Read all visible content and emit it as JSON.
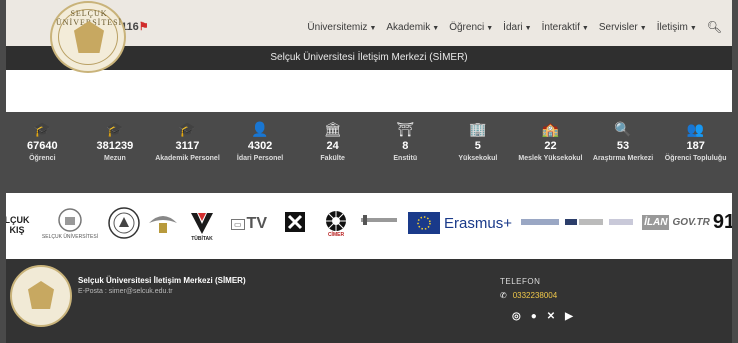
{
  "header": {
    "logo_text": "SELÇUK ÜNİVERSİTESİ",
    "badge": "116",
    "nav": [
      "Üniversitemiz",
      "Akademik",
      "Öğrenci",
      "İdari",
      "İnteraktif",
      "Servisler",
      "İletişim"
    ]
  },
  "title_bar": "Selçuk Üniversitesi İletişim Merkezi (SİMER)",
  "stats": [
    {
      "icon": "student-icon",
      "glyph": "🎓",
      "value": "67640",
      "label": "Öğrenci"
    },
    {
      "icon": "graduate-icon",
      "glyph": "🎓",
      "value": "381239",
      "label": "Mezun"
    },
    {
      "icon": "academic-staff-icon",
      "glyph": "🎓",
      "value": "3117",
      "label": "Akademik Personel"
    },
    {
      "icon": "admin-staff-icon",
      "glyph": "👤",
      "value": "4302",
      "label": "İdari Personel"
    },
    {
      "icon": "faculty-icon",
      "glyph": "🏛",
      "value": "24",
      "label": "Fakülte"
    },
    {
      "icon": "institute-icon",
      "glyph": "⛩",
      "value": "8",
      "label": "Enstitü"
    },
    {
      "icon": "school-icon",
      "glyph": "🏢",
      "value": "5",
      "label": "Yüksekokul"
    },
    {
      "icon": "vocational-icon",
      "glyph": "🏫",
      "value": "22",
      "label": "Meslek Yüksekokul"
    },
    {
      "icon": "research-icon",
      "glyph": "🔍",
      "value": "53",
      "label": "Araştırma Merkezi"
    },
    {
      "icon": "community-icon",
      "glyph": "👥",
      "value": "187",
      "label": "Öğrenci Topluluğu"
    }
  ],
  "partners": {
    "selcuk_cut": "LÇUK\nKIŞ",
    "uzem": "SELÇUK ÜNİVERSİTESİ",
    "tubitak": "TÜBİTAK",
    "tv": "TV",
    "cimer": "CİMER",
    "erasmus": "Erasmus+",
    "ilan": "İLAN",
    "govtr": "GOV.TR",
    "last": "91"
  },
  "footer": {
    "name": "Selçuk Üniversitesi İletişim Merkezi (SİMER)",
    "email": "E-Posta : simer@selcuk.edu.tr",
    "tel_label": "TELEFON",
    "phone": "0332238004"
  },
  "colors": {
    "dark": "#333333",
    "stats_bg": "#4a4a4a",
    "header_bg": "#ece8e2",
    "phone": "#f0c84a"
  }
}
